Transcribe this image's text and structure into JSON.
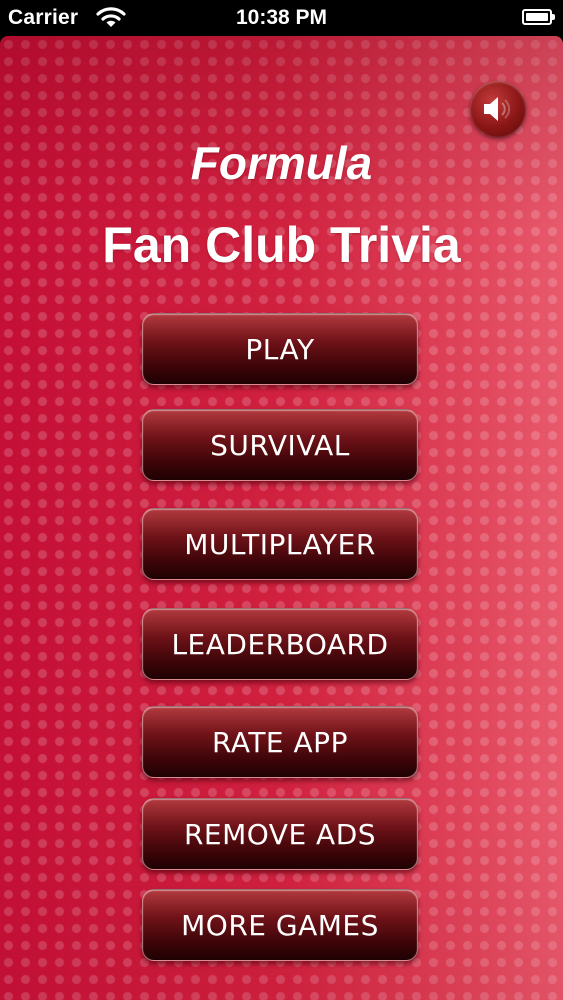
{
  "status_bar": {
    "carrier": "Carrier",
    "time": "10:38 PM",
    "wifi_icon": "wifi-icon",
    "battery_icon": "battery-icon",
    "battery_level": 1.0
  },
  "header": {
    "sound_icon": "speaker-icon",
    "title_line1": "Formula",
    "title_line2": "Fan Club Trivia"
  },
  "menu": {
    "play": "PLAY",
    "survival": "SURVIVAL",
    "multiplayer": "MULTIPLAYER",
    "leaderboard": "LEADERBOARD",
    "rate_app": "RATE APP",
    "remove_ads": "REMOVE ADS",
    "more_games": "MORE GAMES"
  },
  "colors": {
    "background_red": "#c40f36",
    "button_dark": "#3d0508",
    "text": "#ffffff"
  }
}
